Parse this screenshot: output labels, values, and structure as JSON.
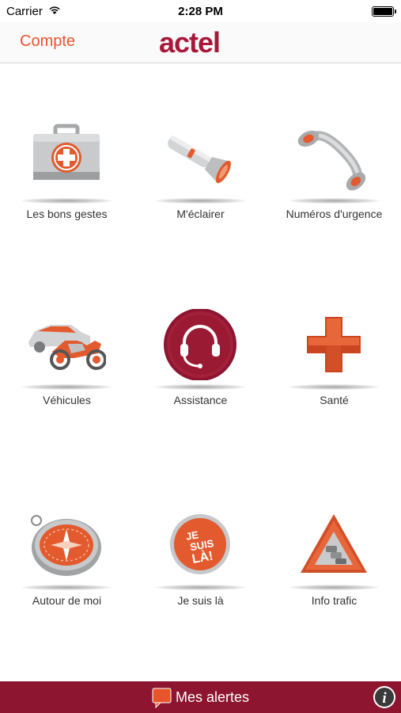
{
  "status_bar": {
    "carrier": "Carrier",
    "time": "2:28 PM"
  },
  "nav": {
    "account_label": "Compte",
    "logo_text": "actel"
  },
  "tiles": [
    {
      "label": "Les bons gestes",
      "icon": "first-aid-kit-icon"
    },
    {
      "label": "M'éclairer",
      "icon": "flashlight-icon"
    },
    {
      "label": "Numéros d'urgence",
      "icon": "phone-handset-icon"
    },
    {
      "label": "Véhicules",
      "icon": "car-motorcycle-icon"
    },
    {
      "label": "Assistance",
      "icon": "headset-icon"
    },
    {
      "label": "Santé",
      "icon": "health-cross-icon"
    },
    {
      "label": "Autour de moi",
      "icon": "compass-icon"
    },
    {
      "label": "Je suis là",
      "icon": "je-suis-la-badge-icon"
    },
    {
      "label": "Info trafic",
      "icon": "traffic-warning-icon"
    }
  ],
  "badge_text": {
    "line1": "JE",
    "line2": "SUIS",
    "line3": "LÀ!"
  },
  "bottom_bar": {
    "alerts_label": "Mes alertes",
    "info_symbol": "i"
  },
  "colors": {
    "accent": "#e8542c",
    "brand_dark": "#8d1530",
    "icon_orange": "#e25a2e",
    "icon_grey": "#b9babc"
  }
}
